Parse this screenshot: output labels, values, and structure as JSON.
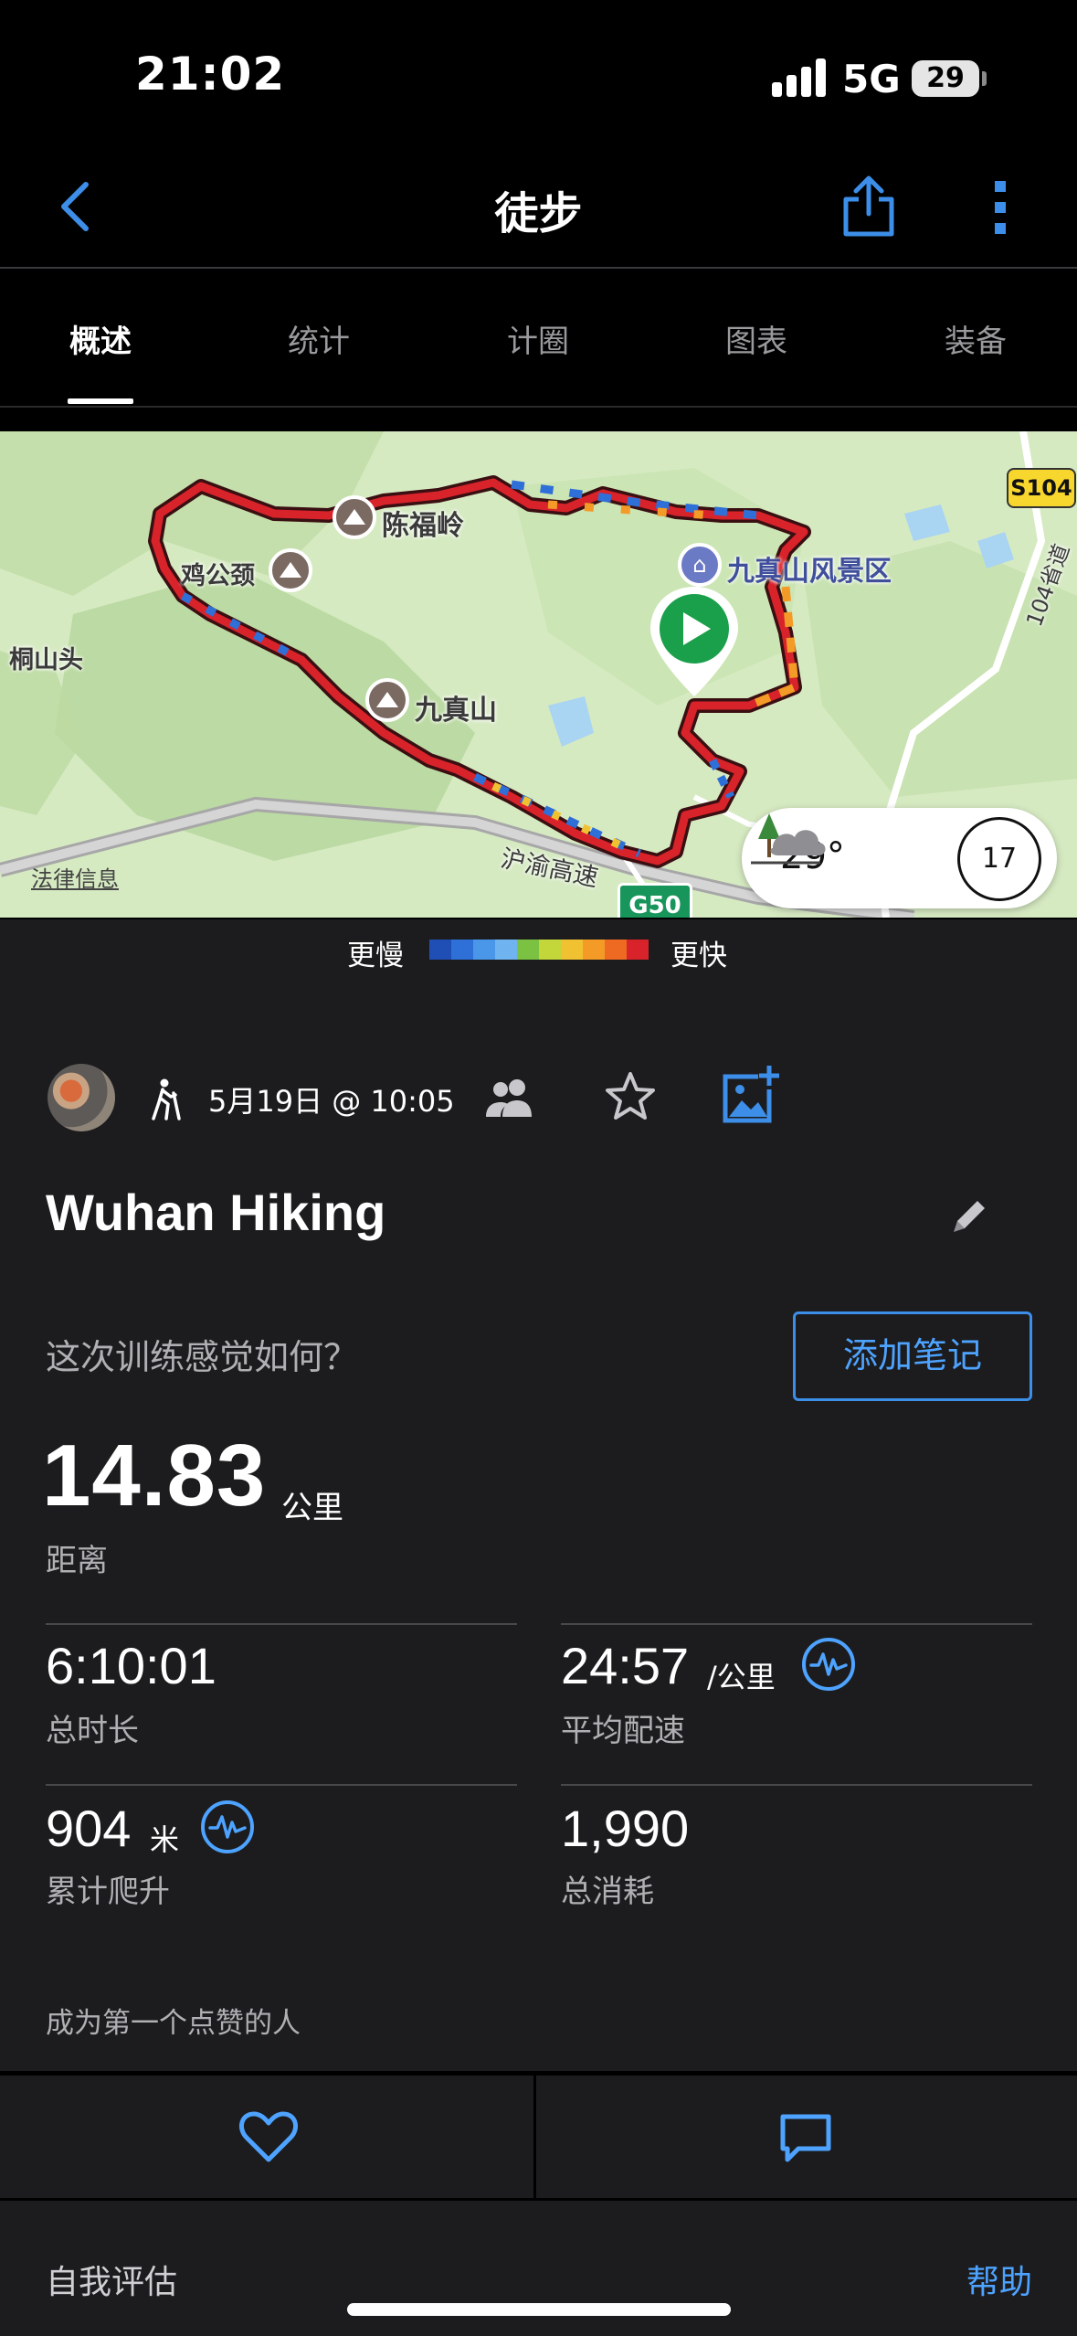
{
  "status_bar": {
    "time": "21:02",
    "network": "5G",
    "battery": "29"
  },
  "nav": {
    "title": "徒步"
  },
  "tabs": [
    {
      "label": "概述",
      "active": true
    },
    {
      "label": "统计",
      "active": false
    },
    {
      "label": "计圈",
      "active": false
    },
    {
      "label": "图表",
      "active": false
    },
    {
      "label": "装备",
      "active": false
    }
  ],
  "map": {
    "labels": {
      "chenfuling": "陈福岭",
      "jigongjing": "鸡公颈",
      "tongshantou": "桐山头",
      "jiuzhenshan": "九真山",
      "scenic_area": "九真山风景区",
      "expressway": "沪渝高速",
      "provincial_road": "104省道",
      "road_badge": "S104",
      "highway_badge": "G50",
      "legal": "法律信息"
    },
    "weather": {
      "temperature": "29°",
      "wind": "17",
      "icon": "cloud-with-tree-icon"
    }
  },
  "pace_legend": {
    "slow": "更慢",
    "fast": "更快",
    "colors": [
      "#1f4fb5",
      "#2f6fd8",
      "#4a97ea",
      "#6fb3f0",
      "#7cc242",
      "#c3d63a",
      "#f0c232",
      "#f39a27",
      "#ee6a23",
      "#d8232a"
    ]
  },
  "activity": {
    "date": "5月19日 @ 10:05",
    "title": "Wuhan Hiking",
    "feeling_prompt": "这次训练感觉如何？",
    "add_note": "添加笔记"
  },
  "stats": {
    "distance": {
      "value": "14.83",
      "unit": "公里",
      "label": "距离"
    },
    "duration": {
      "value": "6:10:01",
      "label": "总时长"
    },
    "pace": {
      "value": "24:57",
      "unit": "/公里",
      "label": "平均配速"
    },
    "ascent": {
      "value": "904",
      "unit": "米",
      "label": "累计爬升"
    },
    "calories": {
      "value": "1,990",
      "label": "总消耗"
    }
  },
  "social": {
    "likes_text": "成为第一个点赞的人"
  },
  "self_evaluation": {
    "title": "自我评估",
    "help": "帮助"
  },
  "accent_color": "#4da3ff"
}
